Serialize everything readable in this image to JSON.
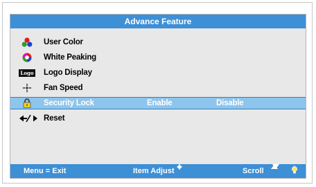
{
  "menu": {
    "title": "Advance Feature",
    "items": [
      {
        "label": "User Color",
        "icon": "user-color-icon"
      },
      {
        "label": "White Peaking",
        "icon": "white-peaking-icon"
      },
      {
        "label": "Logo Display",
        "icon": "logo-icon",
        "icon_text": "Logo"
      },
      {
        "label": "Fan Speed",
        "icon": "fan-icon"
      },
      {
        "label": "Security Lock",
        "icon": "lock-icon",
        "selected": true,
        "options": [
          "Enable",
          "Disable"
        ]
      },
      {
        "label": "Reset",
        "icon": "reset-icon"
      }
    ]
  },
  "footer": {
    "exit": "Menu = Exit",
    "adjust": "Item Adjust",
    "scroll": "Scroll"
  },
  "colors": {
    "bar": "#3d8fd6",
    "selection": "#8ec5ec",
    "panel": "#e8e8e8"
  }
}
